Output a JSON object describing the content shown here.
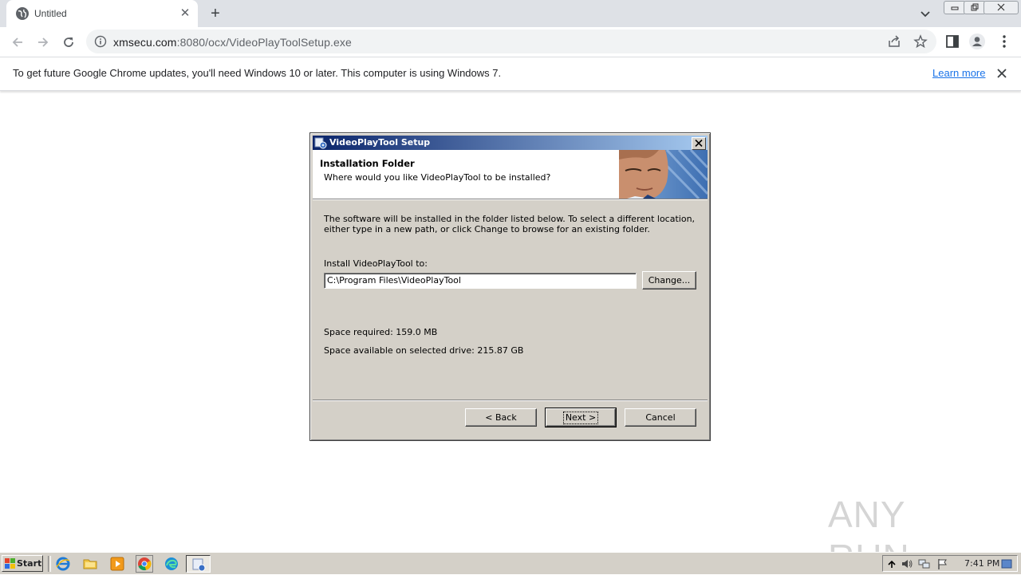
{
  "browser": {
    "tab_title": "Untitled",
    "tab_close": "✕",
    "new_tab": "+",
    "url_host": "xmsecu.com",
    "url_rest": ":8080/ocx/VideoPlayToolSetup.exe"
  },
  "infobar": {
    "message": "To get future Google Chrome updates, you'll need Windows 10 or later. This computer is using Windows 7.",
    "learn_more": "Learn more"
  },
  "dialog": {
    "title": "VideoPlayTool Setup",
    "header_title": "Installation Folder",
    "header_subtitle": "Where would you like VideoPlayTool to be installed?",
    "body_text": "The software will be installed in the folder listed below. To select a different location, either type in a new path, or click Change to browse for an existing folder.",
    "install_label": "Install VideoPlayTool to:",
    "install_path": "C:\\Program Files\\VideoPlayTool",
    "change_button": "Change...",
    "space_required": "Space required: 159.0 MB",
    "space_available": "Space available on selected drive: 215.87 GB",
    "back_button": "< Back",
    "next_button": "Next >",
    "cancel_button": "Cancel"
  },
  "watermark": {
    "text": "ANY RUN"
  },
  "taskbar": {
    "start_label": "Start",
    "clock": "7:41 PM",
    "pinned": [
      "ie-icon",
      "explorer-icon",
      "media-player-icon",
      "chrome-icon",
      "edge-icon",
      "setup-icon"
    ]
  },
  "colors": {
    "titlebar_start": "#0a246a",
    "titlebar_end": "#a6caf0",
    "link": "#1a73e8",
    "dialog_face": "#d4d0c8"
  }
}
